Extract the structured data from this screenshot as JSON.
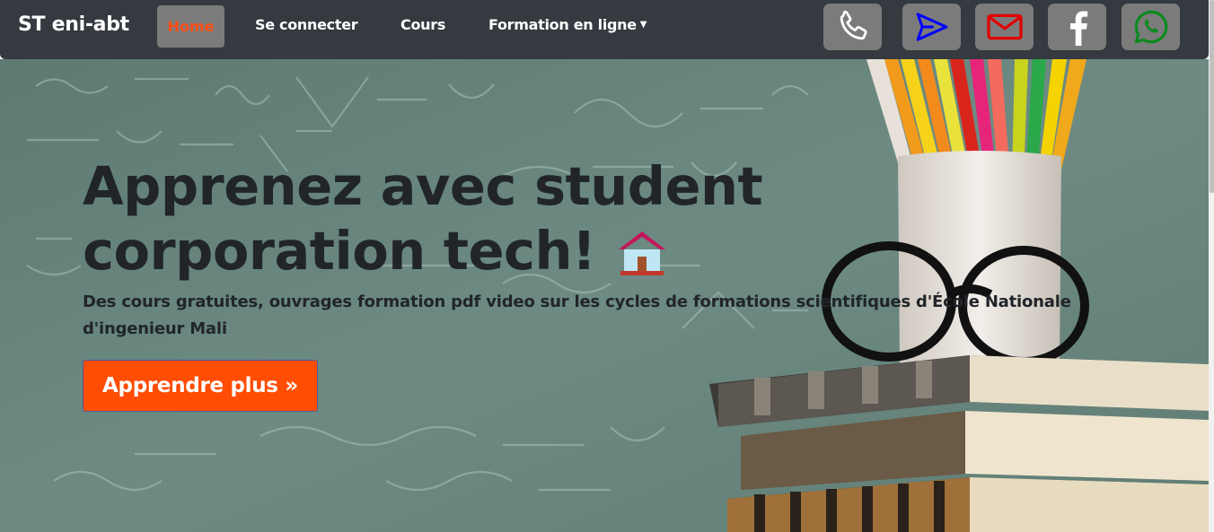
{
  "navbar": {
    "brand": "ST eni-abt",
    "home": "Home",
    "login": "Se connecter",
    "courses": "Cours",
    "formation": "Formation en ligne"
  },
  "social": [
    {
      "icon": "phone-icon",
      "color": "#ffffff"
    },
    {
      "icon": "send-icon",
      "color": "#0000ff"
    },
    {
      "icon": "mail-icon",
      "color": "#e00000"
    },
    {
      "icon": "facebook-icon",
      "color": "#ffffff"
    },
    {
      "icon": "whatsapp-icon",
      "color": "#0a8a1e"
    }
  ],
  "hero": {
    "title": "Apprenez avec student corporation tech!",
    "subtitle": "Des cours gratuites, ouvrages formation pdf video sur les cycles de formations scientifiques d'École Nationale d'ingenieur Mali",
    "cta": "Apprendre plus »"
  },
  "colors": {
    "navbar_bg": "#343a40",
    "accent": "#ff4d03",
    "home_text": "#ff4d14",
    "chalkboard": "#6a8780"
  }
}
